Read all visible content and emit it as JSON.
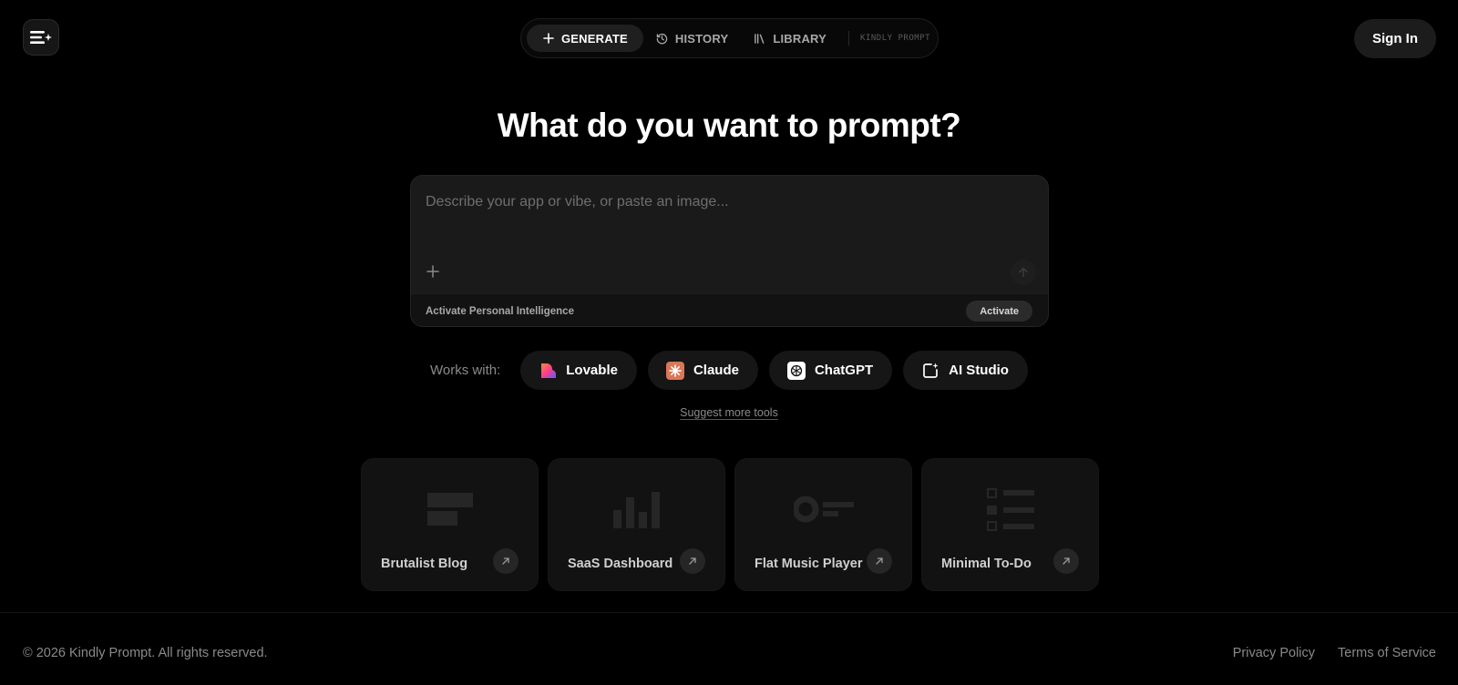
{
  "header": {
    "nav": {
      "generate": "GENERATE",
      "history": "HISTORY",
      "library": "LIBRARY",
      "brand": "KINDLY PROMPT"
    },
    "sign_in": "Sign In"
  },
  "main": {
    "title": "What do you want to prompt?",
    "prompt_placeholder": "Describe your app or vibe, or paste an image...",
    "personal_intelligence": {
      "label": "Activate Personal Intelligence",
      "button": "Activate"
    },
    "works_with": {
      "label": "Works with:",
      "tools": [
        "Lovable",
        "Claude",
        "ChatGPT",
        "AI Studio"
      ]
    },
    "suggest_link": "Suggest more tools",
    "templates": [
      "Brutalist Blog",
      "SaaS Dashboard",
      "Flat Music Player",
      "Minimal To-Do"
    ]
  },
  "footer": {
    "copyright": "© 2026 Kindly Prompt. All rights reserved.",
    "links": [
      "Privacy Policy",
      "Terms of Service"
    ]
  },
  "colors": {
    "background": "#000000",
    "surface": "#1a1a1a",
    "card": "#121212",
    "muted_text": "#8a8a8a",
    "claude_orange": "#d97757"
  }
}
